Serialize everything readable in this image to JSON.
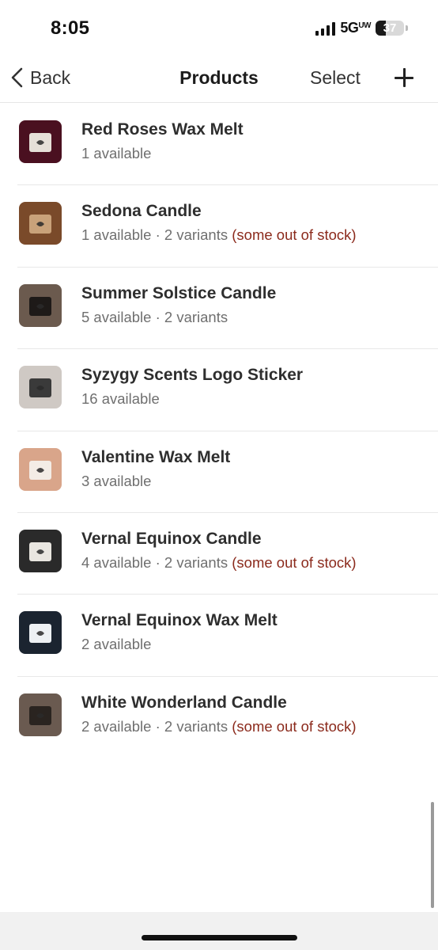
{
  "status_bar": {
    "time": "8:05",
    "network_main": "5G",
    "network_sup": "UW",
    "battery": "37",
    "battery_level": 0.37
  },
  "nav": {
    "back_label": "Back",
    "title": "Products",
    "select_label": "Select",
    "add_icon": "plus-icon"
  },
  "products": [
    {
      "name": "Red Roses Wax Melt",
      "availability": "1 available",
      "variants": "",
      "stock_note": "",
      "thumb_colors": [
        "#4a1020",
        "#e6e0d8"
      ]
    },
    {
      "name": "Sedona Candle",
      "availability": "1 available",
      "variants": " · 2 variants",
      "stock_note": "(some out of stock)",
      "thumb_colors": [
        "#7a4a2a",
        "#c9a27a"
      ]
    },
    {
      "name": "Summer Solstice Candle",
      "availability": "5 available",
      "variants": " · 2 variants",
      "stock_note": "",
      "thumb_colors": [
        "#6b5a4e",
        "#1e1a18"
      ]
    },
    {
      "name": "Syzygy Scents Logo Sticker",
      "availability": "16 available",
      "variants": "",
      "stock_note": "",
      "thumb_colors": [
        "#cfc9c4",
        "#3a3a3a"
      ]
    },
    {
      "name": "Valentine Wax Melt",
      "availability": "3 available",
      "variants": "",
      "stock_note": "",
      "thumb_colors": [
        "#d9a58a",
        "#f3ece6"
      ]
    },
    {
      "name": "Vernal Equinox Candle",
      "availability": "4 available",
      "variants": " · 2 variants",
      "stock_note": "(some out of stock)",
      "thumb_colors": [
        "#2a2a2a",
        "#e9e6e0"
      ]
    },
    {
      "name": "Vernal Equinox Wax Melt",
      "availability": "2 available",
      "variants": "",
      "stock_note": "",
      "thumb_colors": [
        "#1b2430",
        "#eef1f4"
      ]
    },
    {
      "name": "White Wonderland Candle",
      "availability": "2 available",
      "variants": " · 2 variants",
      "stock_note": "(some out of stock)",
      "thumb_colors": [
        "#6a5a50",
        "#2a2420"
      ]
    }
  ],
  "colors": {
    "stock_warning": "#8b2a1c",
    "meta_text": "#6f6f6f",
    "title_text": "#2e2e2e"
  }
}
